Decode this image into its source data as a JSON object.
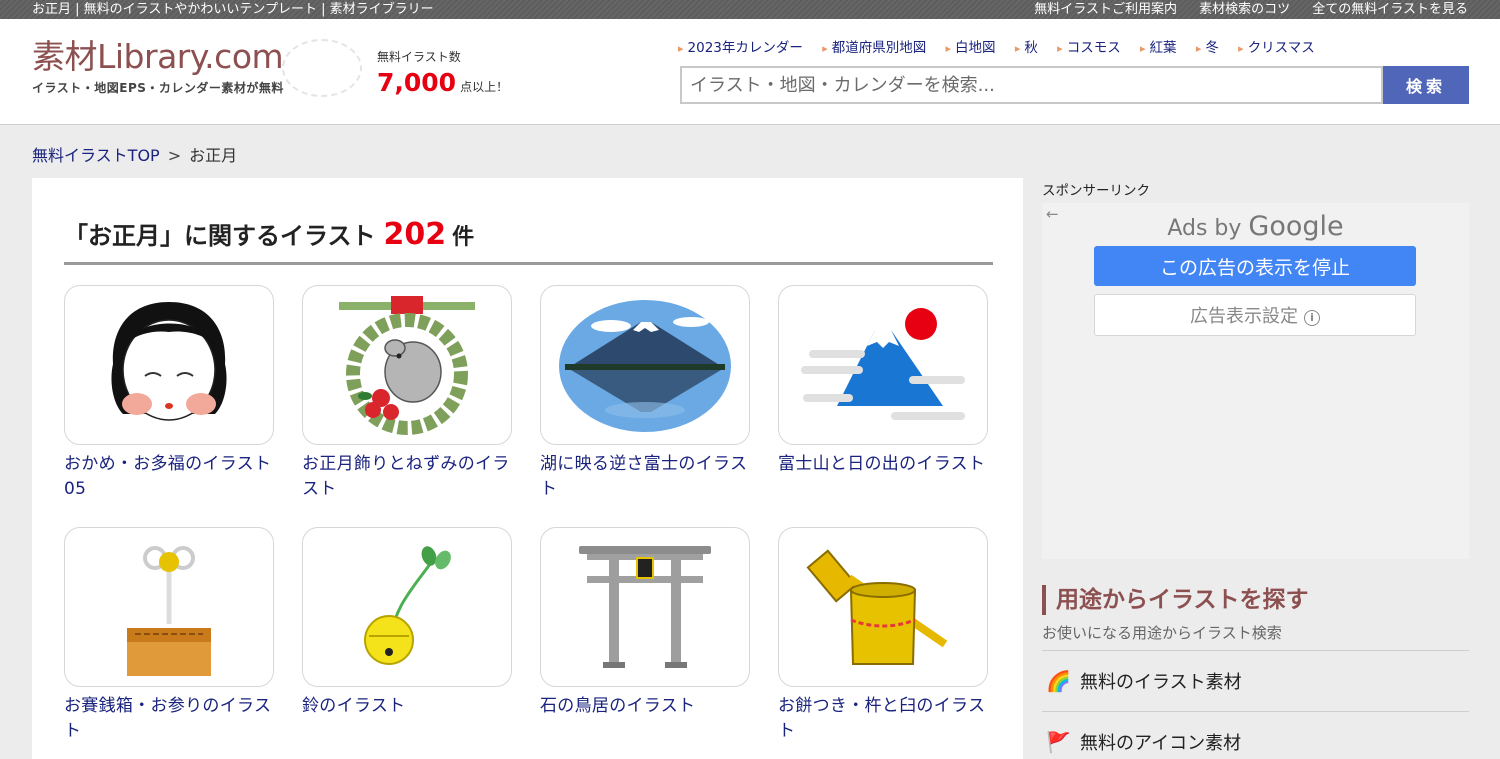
{
  "topbar": {
    "left_text": "お正月 | 無料のイラストやかわいいテンプレート | 素材ライブラリー",
    "right_links": [
      "無料イラストご利用案内",
      "素材検索のコツ",
      "全ての無料イラストを見る"
    ]
  },
  "header": {
    "logo_main": "素材Library.com",
    "logo_sub": "イラスト・地図EPS・カレンダー素材が無料",
    "count_label": "無料イラスト数",
    "count_value": "7,000",
    "count_suffix": "点以上！",
    "quicklinks": [
      "2023年カレンダー",
      "都道府県別地図",
      "白地図",
      "秋",
      "コスモス",
      "紅葉",
      "冬",
      "クリスマス"
    ],
    "search_placeholder": "イラスト・地図・カレンダーを検索...",
    "search_button": "検索"
  },
  "breadcrumb": {
    "home": "無料イラストTOP",
    "separator": ">",
    "current": "お正月"
  },
  "main": {
    "heading_prefix": "「お正月」に関するイラスト",
    "heading_count": "202",
    "heading_unit": "件",
    "cards": [
      {
        "title": "おかめ・お多福のイラスト05",
        "icon": "okame-icon"
      },
      {
        "title": "お正月飾りとねずみのイラスト",
        "icon": "shimekazari-rat-icon"
      },
      {
        "title": "湖に映る逆さ富士のイラスト",
        "icon": "reflected-fuji-icon"
      },
      {
        "title": "富士山と日の出のイラスト",
        "icon": "fuji-sunrise-icon"
      },
      {
        "title": "お賽銭箱・お参りのイラスト",
        "icon": "offering-box-icon"
      },
      {
        "title": "鈴のイラスト",
        "icon": "bell-icon"
      },
      {
        "title": "石の鳥居のイラスト",
        "icon": "torii-icon"
      },
      {
        "title": "お餅つき・杵と臼のイラスト",
        "icon": "mochitsuki-icon"
      }
    ]
  },
  "sidebar": {
    "sponsor_label": "スポンサーリンク",
    "ads_by": "Ads by",
    "ads_google": "Google",
    "ad_stop_button": "この広告の表示を停止",
    "ad_settings_button": "広告表示設定",
    "section_title": "用途からイラストを探す",
    "section_subtitle": "お使いになる用途からイラスト検索",
    "items": [
      {
        "label": "無料のイラスト素材",
        "icon": "rainbow-icon"
      },
      {
        "label": "無料のアイコン素材",
        "icon": "flag-icon"
      }
    ]
  },
  "colors": {
    "accent_red": "#e60012",
    "brand": "#8d5050",
    "link": "#1a237e",
    "search_button": "#5066b8",
    "ad_button": "#4285f4"
  }
}
